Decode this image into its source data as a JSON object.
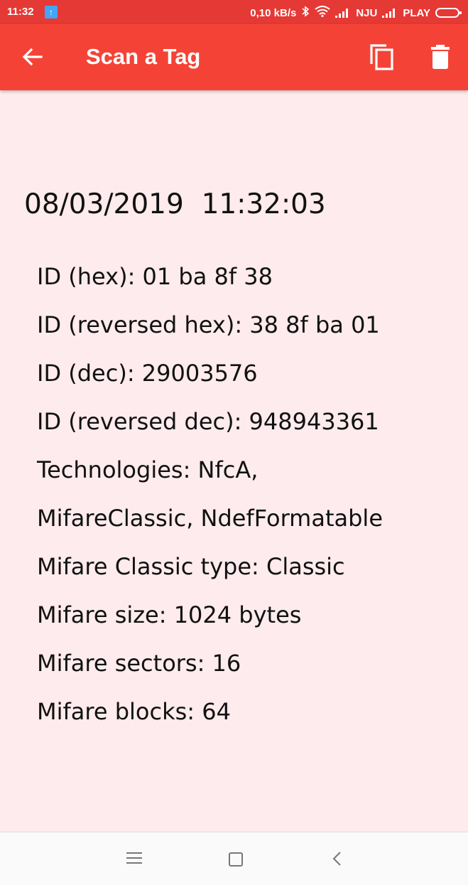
{
  "status_bar": {
    "time": "11:32",
    "network_speed": "0,10 kB/s",
    "carrier1": "NJU",
    "carrier2": "PLAY"
  },
  "app_bar": {
    "title": "Scan a Tag",
    "back_icon": "arrow-back-icon",
    "copy_icon": "copy-icon",
    "delete_icon": "trash-icon"
  },
  "scan": {
    "datetime": "08/03/2019  11:32:03",
    "lines": [
      "ID (hex): 01 ba 8f 38",
      "ID (reversed hex): 38 8f ba 01",
      "ID (dec): 29003576",
      "ID (reversed dec): 948943361",
      "Technologies: NfcA,",
      "MifareClassic, NdefFormatable",
      "Mifare Classic type: Classic",
      "Mifare size: 1024 bytes",
      "Mifare sectors: 16",
      "Mifare blocks: 64"
    ]
  },
  "colors": {
    "status_bar": "#e53935",
    "app_bar": "#f44336",
    "background": "#fdebed"
  }
}
